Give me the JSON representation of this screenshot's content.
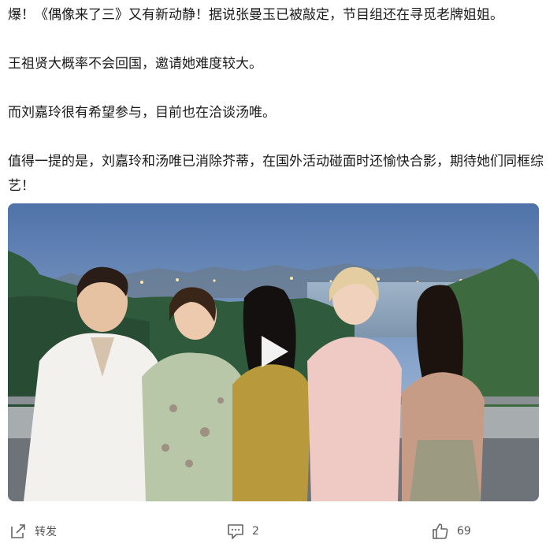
{
  "post": {
    "paragraphs": [
      "爆！《偶像来了三》又有新动静！据说张曼玉已被敲定，节目组还在寻觅老牌姐姐。",
      "王祖贤大概率不会回国，邀请她难度较大。",
      "而刘嘉玲很有希望参与，目前也在洽谈汤唯。",
      "值得一提的是，刘嘉玲和汤唯已消除芥蒂，在国外活动碰面时还愉快合影，期待她们同框综艺！"
    ]
  },
  "media": {
    "type": "video",
    "play_icon": "play-icon"
  },
  "actions": {
    "forward_label": "转发",
    "forward_icon": "share-icon",
    "comment_count": "2",
    "comment_icon": "comment-icon",
    "like_count": "69",
    "like_icon": "thumbs-up-icon"
  },
  "colors": {
    "text": "#1a1a1a",
    "action_text": "#555555",
    "icon": "#666666"
  }
}
